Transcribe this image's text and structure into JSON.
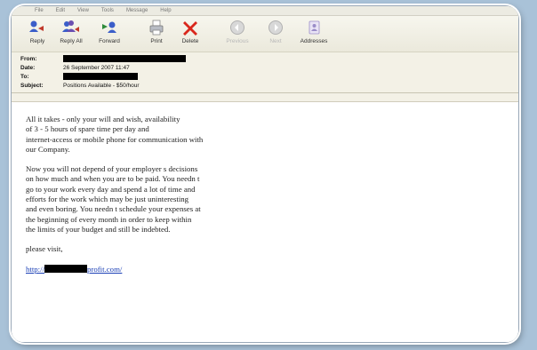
{
  "menu": [
    "File",
    "Edit",
    "View",
    "Tools",
    "Message",
    "Help"
  ],
  "toolbar": {
    "reply": "Reply",
    "reply_all": "Reply All",
    "forward": "Forward",
    "print": "Print",
    "delete": "Delete",
    "previous": "Previous",
    "next": "Next",
    "addresses": "Addresses"
  },
  "headers": {
    "from_label": "From:",
    "date_label": "Date:",
    "date_value": "26 September 2007 11:47",
    "to_label": "To:",
    "subject_label": "Subject:",
    "subject_value": "Positions Available - $50/hour"
  },
  "body": {
    "paragraph1": [
      "All it takes  - only your will and wish, availability",
      "of 3 - 5 hours of spare time per day and",
      "internet-access or mobile phone for communication with",
      "our Company."
    ],
    "paragraph2": [
      "Now you will not depend of your employer s decisions",
      "on how much and when you are to be paid. You needn t",
      "go to your work every day and spend a lot of time and",
      "efforts for the work which may be just uninteresting",
      "and even boring. You needn t schedule your expenses at",
      "the beginning of every month in order to keep within",
      "the  limits of your budget and still be indebted."
    ],
    "closing": "please visit,",
    "link_prefix": "http://",
    "link_suffix": "profit.com/"
  },
  "colors": {
    "background": "#a9c2d8",
    "link": "#1a3fb5",
    "delete_icon": "#d9271c"
  }
}
